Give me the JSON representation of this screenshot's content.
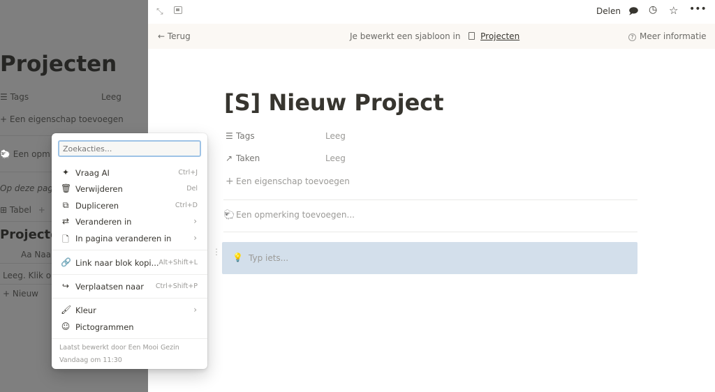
{
  "background": {
    "title": "Projecten",
    "prop_tags_label": "Tags",
    "prop_tags_value": "Leeg",
    "add_property": "Een eigenschap toevoegen",
    "comment": "Een opm",
    "on_page": "Op deze pag",
    "view_tab": "Tabel",
    "view_add": "+",
    "section_title": "Projecter",
    "column_name": "Aa Naar",
    "empty_text": "Leeg. Klik om",
    "new_row": "+ Nieuw"
  },
  "topbar": {
    "share": "Delen"
  },
  "banner": {
    "back": "Terug",
    "editing_text": "Je bewerkt een sjabloon in",
    "template_link": "Projecten",
    "more_info": "Meer informatie"
  },
  "page": {
    "title": "[S] Nieuw Project",
    "properties": [
      {
        "label": "Tags",
        "value": "Leeg"
      },
      {
        "label": "Taken",
        "value": "Leeg"
      }
    ],
    "add_property": "Een eigenschap toevoegen",
    "comment_placeholder": "Een opmerking toevoegen...",
    "block_placeholder": "Typ iets..."
  },
  "menu": {
    "search_placeholder": "Zoekacties...",
    "items": [
      {
        "label": "Vraag AI",
        "shortcut": "Ctrl+J"
      },
      {
        "label": "Verwijderen",
        "shortcut": "Del"
      },
      {
        "label": "Dupliceren",
        "shortcut": "Ctrl+D"
      },
      {
        "label": "Veranderen in",
        "shortcut": ""
      },
      {
        "label": "In pagina veranderen in",
        "shortcut": ""
      },
      {
        "label": "Link naar blok kopi...",
        "shortcut": "Alt+Shift+L"
      },
      {
        "label": "Verplaatsen naar",
        "shortcut": "Ctrl+Shift+P"
      },
      {
        "label": "Kleur",
        "shortcut": ""
      },
      {
        "label": "Pictogrammen",
        "shortcut": ""
      }
    ],
    "last_edited": "Laatst bewerkt door Een Mooi Gezin",
    "last_edited_time": "Vandaag om 11:30"
  },
  "colors": {
    "overlay": "#7f7f7f",
    "block_highlight": "#d3dfeb",
    "search_focus": "#9ec3e6"
  }
}
